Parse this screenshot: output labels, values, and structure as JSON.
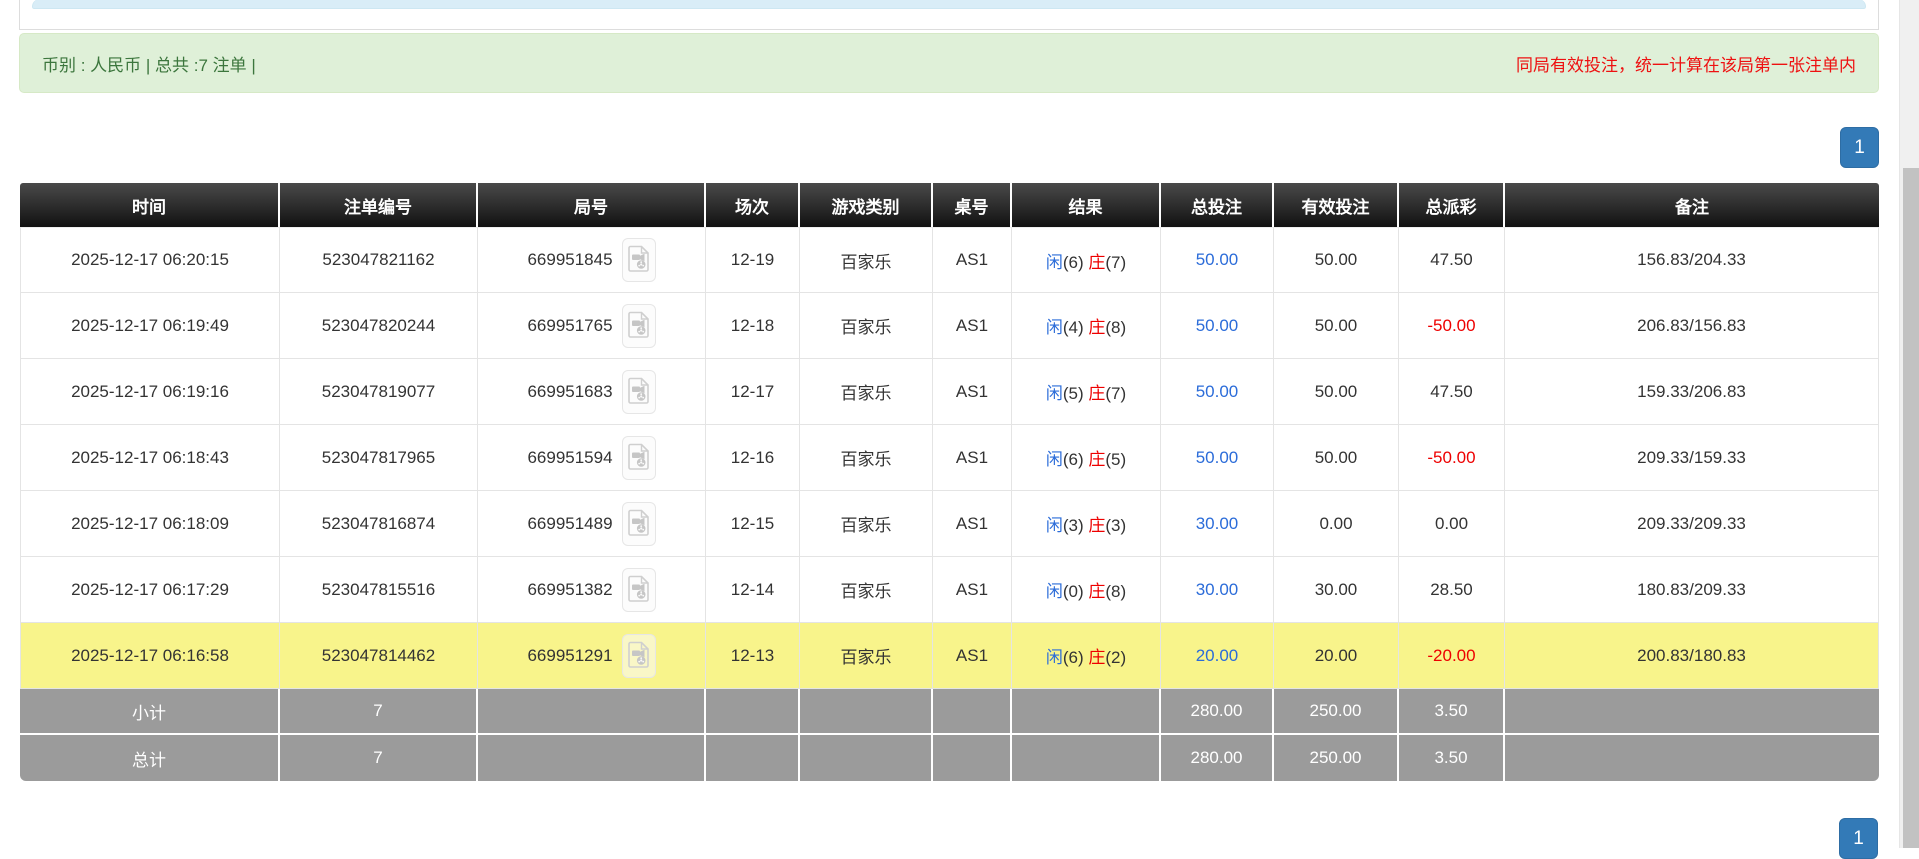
{
  "info_bar": {
    "left_text": "币别 : 人民币 | 总共 :7 注单 |",
    "right_text": "同局有效投注，统一计算在该局第一张注单内"
  },
  "pagination": {
    "page": "1"
  },
  "icons": {
    "video_icon": "video-file",
    "scrollbar": "vertical-scrollbar"
  },
  "colors": {
    "info_bg": "#dff0d8",
    "info_text": "#3c763d",
    "warning_text": "#ee1111",
    "header_bg": "#1a1a1a",
    "link_blue": "#2b6cd9",
    "negative_red": "#ee0000",
    "highlight_yellow": "#f8f48b",
    "summary_gray": "#9b9b9b",
    "pager_blue": "#337ab7"
  },
  "table": {
    "headers": [
      "时间",
      "注单编号",
      "局号",
      "场次",
      "游戏类别",
      "桌号",
      "结果",
      "总投注",
      "有效投注",
      "总派彩",
      "备注"
    ],
    "rows": [
      {
        "time": "2025-12-17 06:20:15",
        "bet_id": "523047821162",
        "round": "669951845",
        "session": "12-19",
        "game_type": "百家乐",
        "table_no": "AS1",
        "result": {
          "player_label": "闲",
          "player_score": "(6)",
          "banker_label": "庄",
          "banker_score": "(7)"
        },
        "total_bet": "50.00",
        "valid_bet": "50.00",
        "payout": "47.50",
        "remark": "156.83/204.33",
        "highlight": false
      },
      {
        "time": "2025-12-17 06:19:49",
        "bet_id": "523047820244",
        "round": "669951765",
        "session": "12-18",
        "game_type": "百家乐",
        "table_no": "AS1",
        "result": {
          "player_label": "闲",
          "player_score": "(4)",
          "banker_label": "庄",
          "banker_score": "(8)"
        },
        "total_bet": "50.00",
        "valid_bet": "50.00",
        "payout": "-50.00",
        "remark": "206.83/156.83",
        "highlight": false
      },
      {
        "time": "2025-12-17 06:19:16",
        "bet_id": "523047819077",
        "round": "669951683",
        "session": "12-17",
        "game_type": "百家乐",
        "table_no": "AS1",
        "result": {
          "player_label": "闲",
          "player_score": "(5)",
          "banker_label": "庄",
          "banker_score": "(7)"
        },
        "total_bet": "50.00",
        "valid_bet": "50.00",
        "payout": "47.50",
        "remark": "159.33/206.83",
        "highlight": false
      },
      {
        "time": "2025-12-17 06:18:43",
        "bet_id": "523047817965",
        "round": "669951594",
        "session": "12-16",
        "game_type": "百家乐",
        "table_no": "AS1",
        "result": {
          "player_label": "闲",
          "player_score": "(6)",
          "banker_label": "庄",
          "banker_score": "(5)"
        },
        "total_bet": "50.00",
        "valid_bet": "50.00",
        "payout": "-50.00",
        "remark": "209.33/159.33",
        "highlight": false
      },
      {
        "time": "2025-12-17 06:18:09",
        "bet_id": "523047816874",
        "round": "669951489",
        "session": "12-15",
        "game_type": "百家乐",
        "table_no": "AS1",
        "result": {
          "player_label": "闲",
          "player_score": "(3)",
          "banker_label": "庄",
          "banker_score": "(3)"
        },
        "total_bet": "30.00",
        "valid_bet": "0.00",
        "payout": "0.00",
        "remark": "209.33/209.33",
        "highlight": false
      },
      {
        "time": "2025-12-17 06:17:29",
        "bet_id": "523047815516",
        "round": "669951382",
        "session": "12-14",
        "game_type": "百家乐",
        "table_no": "AS1",
        "result": {
          "player_label": "闲",
          "player_score": "(0)",
          "banker_label": "庄",
          "banker_score": "(8)"
        },
        "total_bet": "30.00",
        "valid_bet": "30.00",
        "payout": "28.50",
        "remark": "180.83/209.33",
        "highlight": false
      },
      {
        "time": "2025-12-17 06:16:58",
        "bet_id": "523047814462",
        "round": "669951291",
        "session": "12-13",
        "game_type": "百家乐",
        "table_no": "AS1",
        "result": {
          "player_label": "闲",
          "player_score": "(6)",
          "banker_label": "庄",
          "banker_score": "(2)"
        },
        "total_bet": "20.00",
        "valid_bet": "20.00",
        "payout": "-20.00",
        "remark": "200.83/180.83",
        "highlight": true
      }
    ],
    "summary_rows": [
      {
        "label": "小计",
        "count": "7",
        "total_bet": "280.00",
        "valid_bet": "250.00",
        "payout": "3.50"
      },
      {
        "label": "总计",
        "count": "7",
        "total_bet": "280.00",
        "valid_bet": "250.00",
        "payout": "3.50"
      }
    ]
  }
}
